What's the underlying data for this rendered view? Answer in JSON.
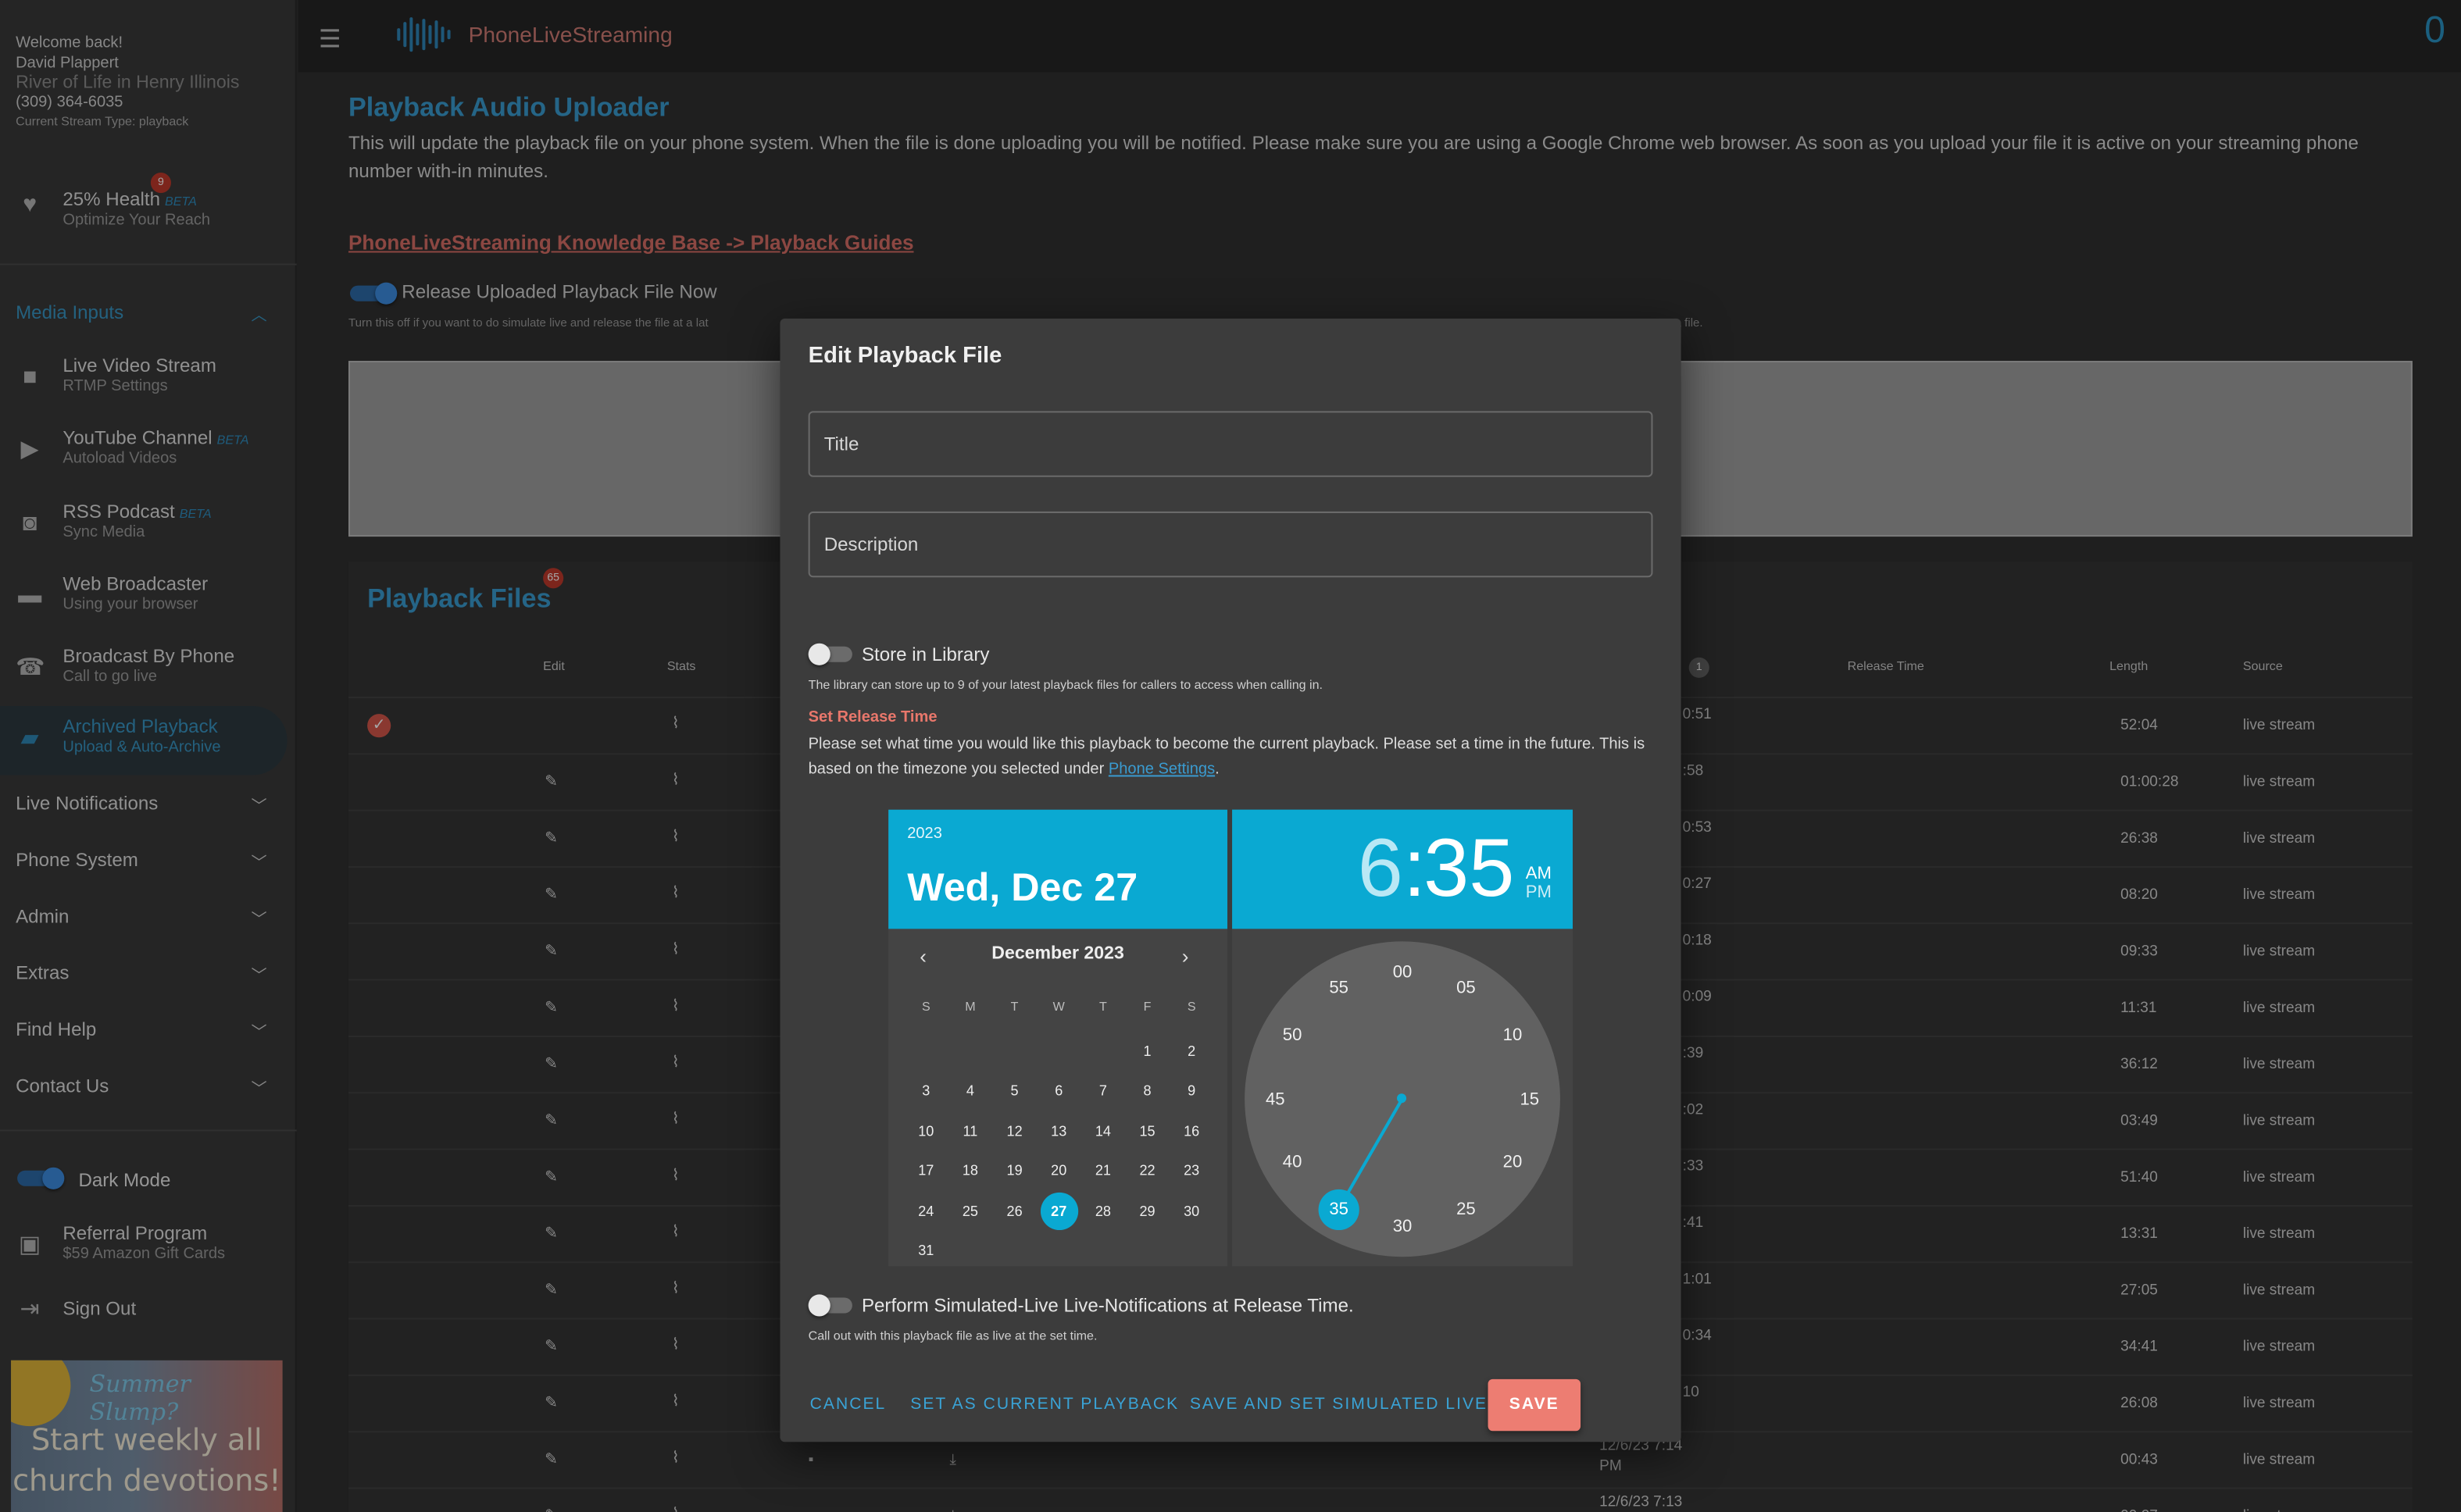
{
  "user": {
    "welcome": "Welcome back!",
    "name": "David Plappert",
    "church": "River of Life in Henry Illinois",
    "phone": "(309) 364-6035",
    "stream_type": "Current Stream Type: playback"
  },
  "health": {
    "label": "25% Health",
    "beta": "BETA",
    "sub": "Optimize Your Reach",
    "badge": "9"
  },
  "media_inputs": {
    "header": "Media Inputs",
    "items": [
      {
        "label": "Live Video Stream",
        "sub": "RTMP Settings",
        "beta": ""
      },
      {
        "label": "YouTube Channel",
        "sub": "Autoload Videos",
        "beta": "BETA"
      },
      {
        "label": "RSS Podcast",
        "sub": "Sync Media",
        "beta": "BETA"
      },
      {
        "label": "Web Broadcaster",
        "sub": "Using your browser",
        "beta": ""
      },
      {
        "label": "Broadcast By Phone",
        "sub": "Call to go live",
        "beta": ""
      },
      {
        "label": "Archived Playback",
        "sub": "Upload & Auto-Archive",
        "beta": ""
      }
    ]
  },
  "sections": [
    "Live Notifications",
    "Phone System",
    "Admin",
    "Extras",
    "Find Help",
    "Contact Us"
  ],
  "dark_mode": "Dark Mode",
  "referral": {
    "label": "Referral Program",
    "sub": "$59 Amazon Gift Cards"
  },
  "sign_out": "Sign Out",
  "ad": {
    "line1": "Summer Slump?",
    "line2": "Start weekly all",
    "line3": "church devotions!"
  },
  "topbar": {
    "brand": "PhoneLiveStreaming",
    "count": "0"
  },
  "page": {
    "title": "Playback Audio Uploader",
    "description": "This will update the playback file on your phone system. When the file is done uploading you will be notified. Please make sure you are using a Google Chrome web browser. As soon as you upload your file it is active on your streaming phone number with-in minutes.",
    "kb_link": "PhoneLiveStreaming Knowledge Base -> Playback Guides",
    "release_toggle": "Release Uploaded Playback File Now",
    "release_desc_left": "Turn this off if you want to do simulate live and release the file at a lat",
    "release_desc_right": "a file."
  },
  "files": {
    "title": "Playback Files",
    "badge": "65",
    "headers": {
      "edit": "Edit",
      "stats": "Stats",
      "release": "Release Time",
      "length": "Length",
      "source": "Source",
      "sort_badge": "1"
    },
    "rows": [
      {
        "frag": "0:51",
        "length": "52:04",
        "source": "live stream"
      },
      {
        "frag": ":58",
        "length": "01:00:28",
        "source": "live stream"
      },
      {
        "frag": "0:53",
        "length": "26:38",
        "source": "live stream"
      },
      {
        "frag": "0:27",
        "length": "08:20",
        "source": "live stream"
      },
      {
        "frag": "0:18",
        "length": "09:33",
        "source": "live stream"
      },
      {
        "frag": "0:09",
        "length": "11:31",
        "source": "live stream"
      },
      {
        "frag": ":39",
        "length": "36:12",
        "source": "live stream"
      },
      {
        "frag": ":02",
        "length": "03:49",
        "source": "live stream"
      },
      {
        "frag": ":33",
        "length": "51:40",
        "source": "live stream"
      },
      {
        "frag": ":41",
        "length": "13:31",
        "source": "live stream"
      },
      {
        "frag": "1:01",
        "length": "27:05",
        "source": "live stream"
      },
      {
        "frag": "0:34",
        "length": "34:41",
        "source": "live stream"
      },
      {
        "frag": "10",
        "length": "26:08",
        "source": "live stream"
      },
      {
        "frag": "12/6/23 7:14 PM",
        "length": "00:43",
        "source": "live stream"
      },
      {
        "frag": "12/6/23 7:13",
        "length": "00:27",
        "source": "live stream"
      }
    ]
  },
  "dialog": {
    "title": "Edit Playback File",
    "title_placeholder": "Title",
    "description_placeholder": "Description",
    "store_library": "Store in Library",
    "library_hint": "The library can store up to 9 of your latest playback files for callers to access when calling in.",
    "set_release": "Set Release Time",
    "release_text": "Please set what time you would like this playback to become the current playback. Please set a time in the future. This is based on the timezone you selected under ",
    "phone_settings": "Phone Settings",
    "period": ".",
    "calendar": {
      "year": "2023",
      "date": "Wed, Dec 27",
      "month": "December 2023",
      "dow": [
        "S",
        "M",
        "T",
        "W",
        "T",
        "F",
        "S"
      ],
      "days": [
        "1",
        "2",
        "3",
        "4",
        "5",
        "6",
        "7",
        "8",
        "9",
        "10",
        "11",
        "12",
        "13",
        "14",
        "15",
        "16",
        "17",
        "18",
        "19",
        "20",
        "21",
        "22",
        "23",
        "24",
        "25",
        "26",
        "27",
        "28",
        "29",
        "30",
        "31"
      ],
      "selected": "27"
    },
    "clock": {
      "hour": "6",
      "colon": ":",
      "minute": "35",
      "am": "AM",
      "pm": "PM",
      "numbers": [
        "00",
        "05",
        "10",
        "15",
        "20",
        "25",
        "30",
        "35",
        "40",
        "45",
        "50",
        "55"
      ],
      "selected": "35"
    },
    "simulated": "Perform Simulated-Live Live-Notifications at Release Time.",
    "simulated_hint": "Call out with this playback file as live at the set time.",
    "actions": {
      "cancel": "CANCEL",
      "set_current": "SET AS CURRENT PLAYBACK",
      "save_sim": "SAVE AND SET SIMULATED LIVE",
      "save": "SAVE"
    }
  },
  "colors": {
    "accent": "#0aa9d2",
    "link": "#3a9bd0",
    "brand": "#d17b74",
    "save": "#ed7d72"
  }
}
